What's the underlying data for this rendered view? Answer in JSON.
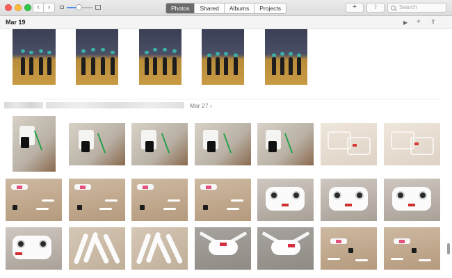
{
  "toolbar": {
    "tabs": [
      {
        "label": "Photos",
        "active": true
      },
      {
        "label": "Shared",
        "active": false
      },
      {
        "label": "Albums",
        "active": false
      },
      {
        "label": "Projects",
        "active": false
      }
    ],
    "back_glyph": "‹",
    "forward_glyph": "›",
    "add_glyph": "+",
    "share_glyph": "⇪",
    "search_placeholder": "Search",
    "zoom_level": 0.45
  },
  "moment1": {
    "date": "Mar 19",
    "play_glyph": "▶",
    "add_glyph": "+",
    "share_glyph": "⇪"
  },
  "moment2": {
    "date": "Mar 27 ›"
  },
  "photos": {
    "roller_derby": 5,
    "drone_unboxing": 22
  },
  "colors": {
    "accent": "#4a8ef0",
    "active_tab": "#6b6b6b"
  }
}
